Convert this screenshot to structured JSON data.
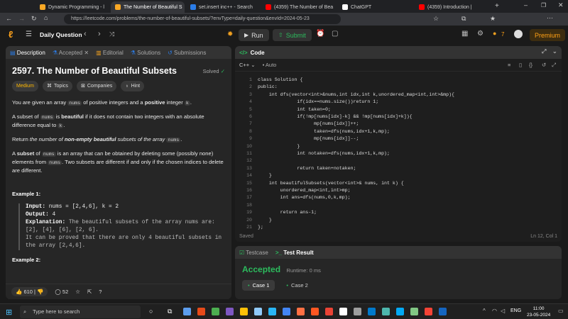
{
  "browser": {
    "tabs": [
      {
        "label": "Dynamic Programming - l",
        "color": "#f9a825"
      },
      {
        "label": "The Number of Beautiful S",
        "color": "#f9a825"
      },
      {
        "label": "set.insert inc++ - Search",
        "color": "#2b7de9"
      },
      {
        "label": "(4359) The Number of Bea",
        "color": "#ff0000"
      },
      {
        "label": "ChatGPT",
        "color": "#ffffff"
      },
      {
        "label": "(4359) Introduction |",
        "color": "#ff0000"
      }
    ],
    "url": "https://leetcode.com/problems/the-number-of-beautiful-subsets/?envType=daily-question&envId=2024-05-23"
  },
  "header": {
    "title": "Daily Question",
    "run": "Run",
    "submit": "Submit",
    "streak": "7",
    "premium": "Premium"
  },
  "left": {
    "tabs": [
      "Description",
      "Accepted",
      "Editorial",
      "Solutions",
      "Submissions"
    ],
    "title": "2597. The Number of Beautiful Subsets",
    "solved": "Solved",
    "tags": [
      "Medium",
      "Topics",
      "Companies",
      "Hint"
    ],
    "p1a": "You are given an array ",
    "p1code": "nums",
    "p1b": " of positive integers and a ",
    "p1bold": "positive",
    "p1c": " integer ",
    "p1k": "k",
    "p1d": ".",
    "p2a": "A subset of ",
    "p2code": "nums",
    "p2b": " is ",
    "p2bold": "beautiful",
    "p2c": " if it does not contain two integers with an absolute difference equal to ",
    "p2k": "k",
    "p2d": ".",
    "p3a": "Return ",
    "p3i": "the number of ",
    "p3bi": "non-empty beautiful",
    "p3i2": " subsets of the array ",
    "p3code": "nums",
    "p3d": ".",
    "p4a": "A ",
    "p4bold": "subset",
    "p4b": " of ",
    "p4code": "nums",
    "p4c": " is an array that can be obtained by deleting some (possibly none) elements from ",
    "p4code2": "nums",
    "p4d": ". Two subsets are different if and only if the chosen indices to delete are different.",
    "ex1": "Example 1:",
    "ex_input_label": "Input:",
    "ex_input": " nums = [2,4,6], k = 2",
    "ex_output_label": "Output:",
    "ex_output": " 4",
    "ex_expl_label": "Explanation:",
    "ex_expl": " The beautiful subsets of the array nums are: [2], [4], [6], [2, 6].",
    "ex_expl2": "It can be proved that there are only 4 beautiful subsets in the array [2,4,6].",
    "ex2": "Example 2:",
    "likes": "610",
    "comments": "52"
  },
  "code": {
    "title": "Code",
    "lang": "C++",
    "auto": "Auto",
    "lines": [
      "class Solution {",
      "public:",
      "    int dfs(vector<int>&nums,int idx,int k,unordered_map<int,int>&mp){",
      "              if(idx==nums.size())return 1;",
      "              int taken=0;",
      "              if(!mp[nums[idx]-k] && !mp[nums[idx]+k]){",
      "                    mp[nums[idx]]++;",
      "                    taken=dfs(nums,idx+1,k,mp);",
      "                    mp[nums[idx]]--;",
      "              }",
      "              int notaken=dfs(nums,idx+1,k,mp);",
      "",
      "              return taken+notaken;",
      "    }",
      "    int beautifulSubsets(vector<int>& nums, int k) {",
      "        unordered_map<int,int>mp;",
      "        int ans=dfs(nums,0,k,mp);",
      "",
      "        return ans-1;",
      "    }",
      "};"
    ],
    "status": "Saved",
    "position": "Ln 12, Col 1"
  },
  "results": {
    "tab1": "Testcase",
    "tab2": "Test Result",
    "verdict": "Accepted",
    "runtime": "Runtime: 0 ms",
    "case1": "Case 1",
    "case2": "Case 2"
  },
  "taskbar": {
    "search": "Type here to search",
    "lang": "ENG",
    "time": "11:00",
    "date": "23-05-2024"
  }
}
